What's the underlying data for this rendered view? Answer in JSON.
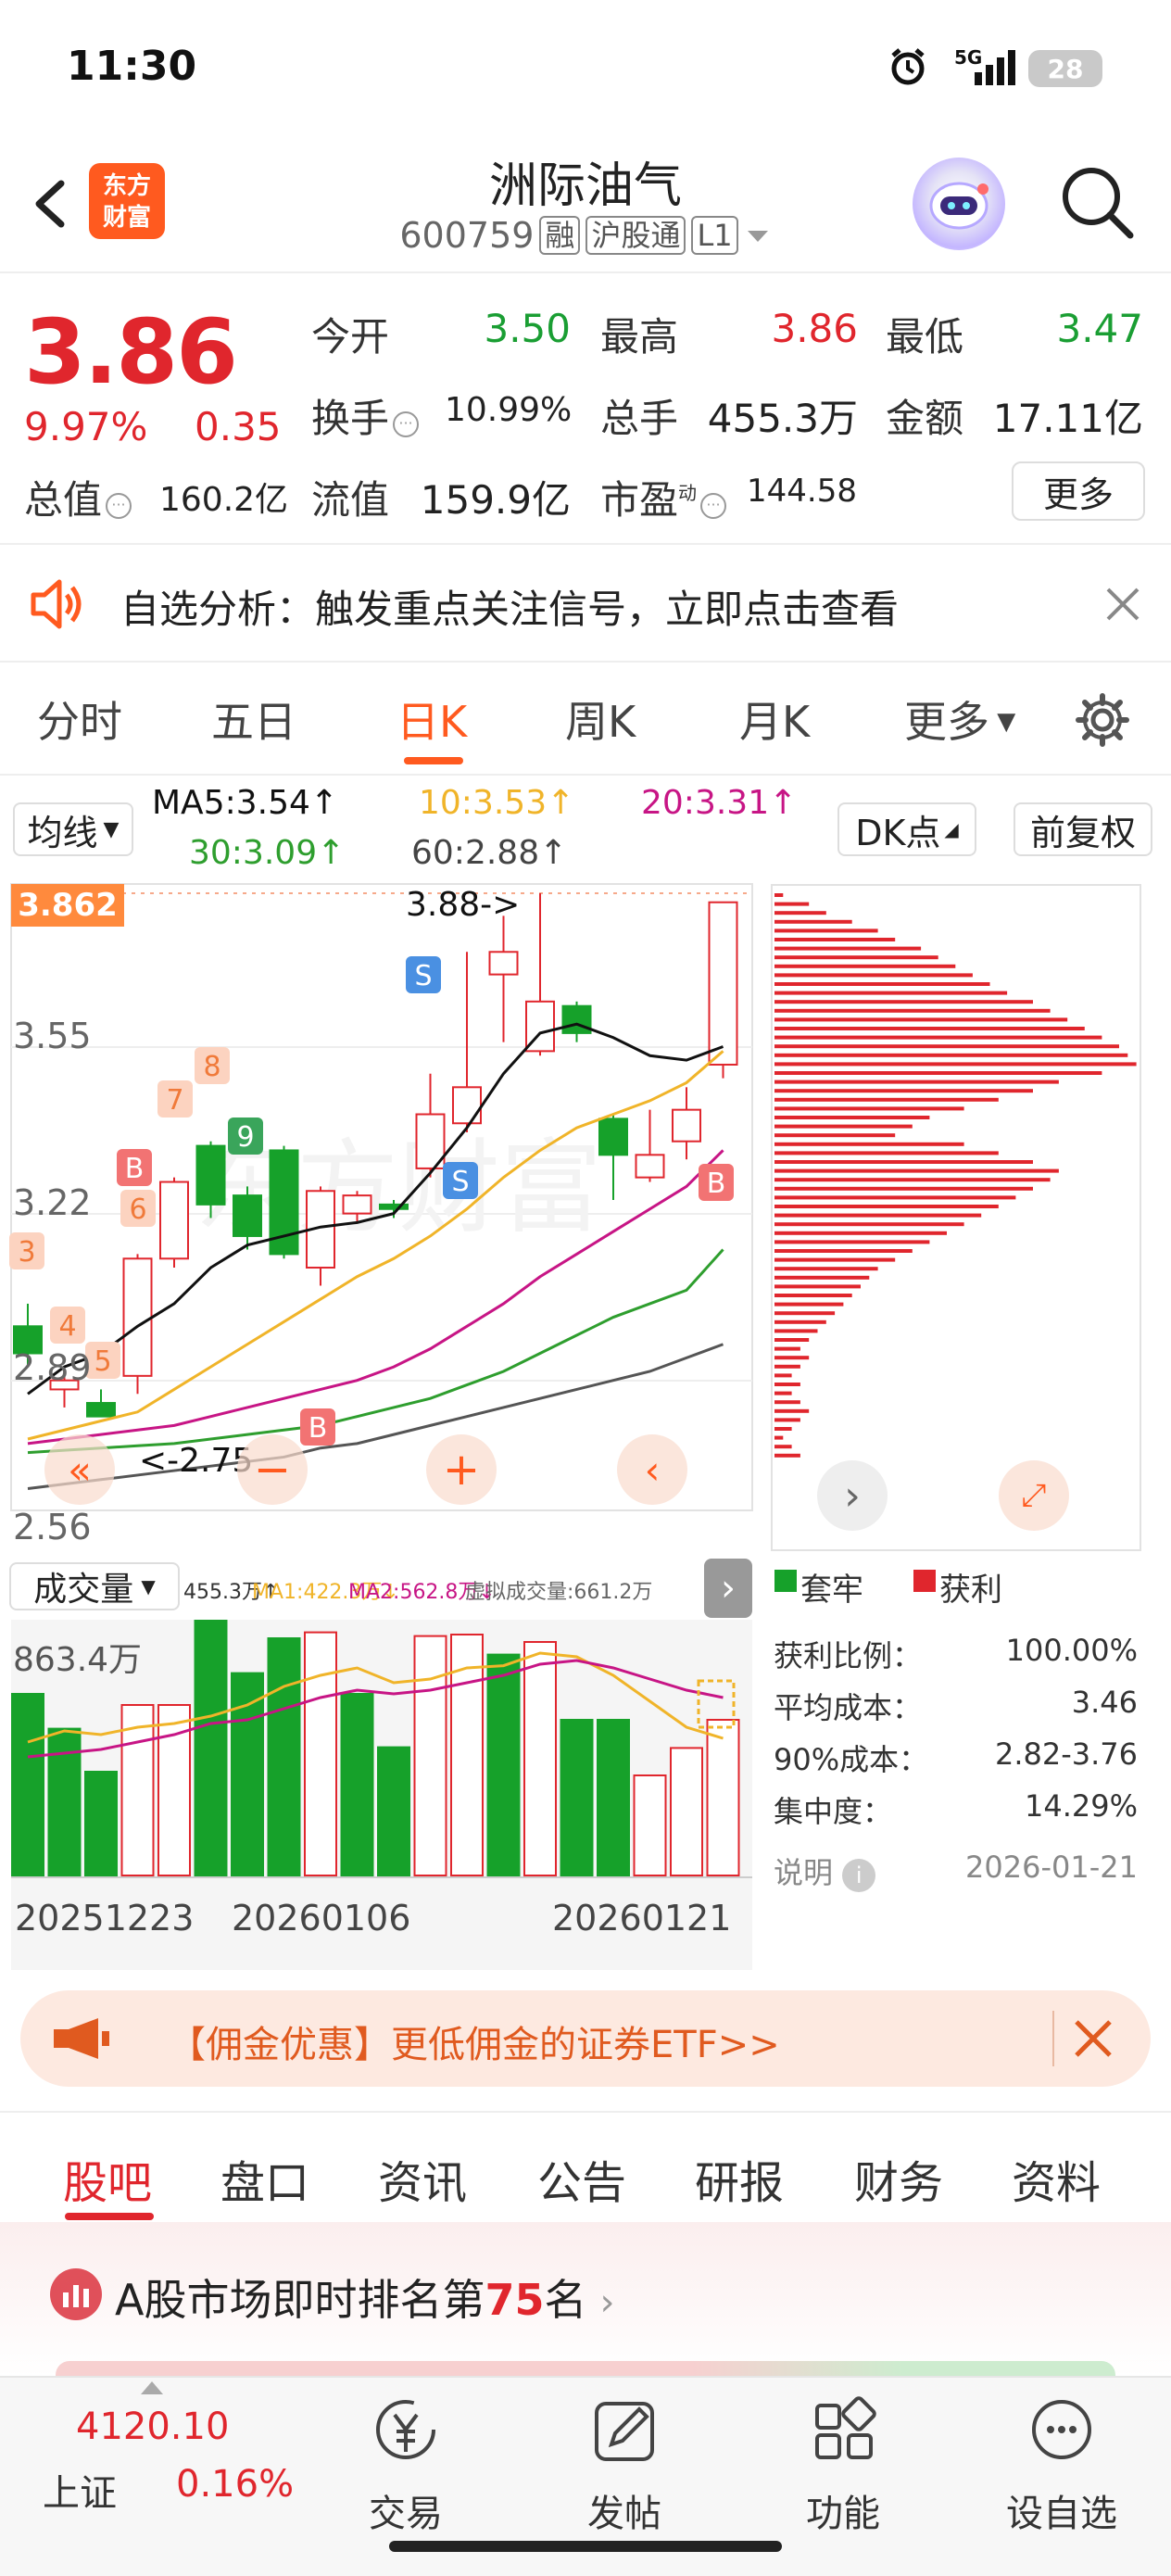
{
  "status_bar": {
    "time": "11:30",
    "network": "5G",
    "battery": "28"
  },
  "header": {
    "logo_line1": "东方",
    "logo_line2": "财富",
    "stock_name": "洲际油气",
    "stock_code": "600759",
    "tags": [
      "融",
      "沪股通",
      "L1"
    ]
  },
  "quote": {
    "price": "3.86",
    "change_pct": "9.97%",
    "change_amt": "0.35",
    "total_value_label": "总值",
    "total_value": "160.2亿",
    "open_label": "今开",
    "open": "3.50",
    "high_label": "最高",
    "high": "3.86",
    "low_label": "最低",
    "low": "3.47",
    "turnover_label": "换手",
    "turnover": "10.99%",
    "volume_label": "总手",
    "volume": "455.3万",
    "amount_label": "金额",
    "amount": "17.11亿",
    "float_label": "流值",
    "float_value": "159.9亿",
    "pe_label": "市盈",
    "pe_sup": "动",
    "pe": "144.58",
    "more_label": "更多"
  },
  "notice": {
    "text": "自选分析：触发重点关注信号，立即点击查看"
  },
  "period_tabs": [
    "分时",
    "五日",
    "日K",
    "周K",
    "月K",
    "更多"
  ],
  "period_active": "日K",
  "indicators": {
    "ma_select": "均线",
    "ma5": "MA5:3.54↑",
    "ma10": "10:3.53↑",
    "ma20": "20:3.31↑",
    "ma30": "30:3.09↑",
    "ma60": "60:2.88↑",
    "dk_label": "DK点",
    "adjust_label": "前复权"
  },
  "kline": {
    "current_tag": "3.862",
    "y_labels": [
      "3.55",
      "3.22",
      "2.89",
      "2.56"
    ],
    "high_mark": "3.88->",
    "low_mark": "<-2.75",
    "signals": [
      "B",
      "S",
      "S",
      "B",
      "B",
      "B"
    ],
    "count_marks": [
      "3",
      "4",
      "5",
      "6",
      "7",
      "8",
      "9"
    ],
    "colors": {
      "up": "#e0262d",
      "down": "#16a12a",
      "ma5": "#111111",
      "ma10": "#f0b429",
      "ma20": "#c71585",
      "ma30": "#2e9e2e",
      "ma60": "#555555"
    }
  },
  "volume": {
    "select": "成交量",
    "vol": "455.3万↑",
    "ma1": "MA1:422.3万↓",
    "ma2": "MA2:562.8万↓",
    "virtual": "虚拟成交量:661.2万",
    "max_label": "863.4万",
    "dates": [
      "20251223",
      "20260106",
      "20260121"
    ]
  },
  "chips": {
    "legend_trapped": "套牢",
    "legend_profit": "获利",
    "stats": [
      {
        "label": "获利比例：",
        "value": "100.00%"
      },
      {
        "label": "平均成本：",
        "value": "3.46"
      },
      {
        "label": "90%成本：",
        "value": "2.82-3.76"
      },
      {
        "label": "集中度：",
        "value": "14.29%"
      }
    ],
    "note_label": "说明",
    "date": "2026-01-21"
  },
  "promo": {
    "text": "【佣金优惠】更低佣金的证券ETF>>"
  },
  "bottom_tabs": [
    "股吧",
    "盘口",
    "资讯",
    "公告",
    "研报",
    "财务",
    "资料"
  ],
  "ranking": {
    "prefix": "A股市场即时排名第",
    "rank": "75",
    "suffix": "名"
  },
  "bottom_nav": {
    "index_value": "4120.10",
    "index_name": "上证",
    "index_change": "0.16%",
    "items": [
      "交易",
      "发帖",
      "功能",
      "设自选"
    ]
  }
}
